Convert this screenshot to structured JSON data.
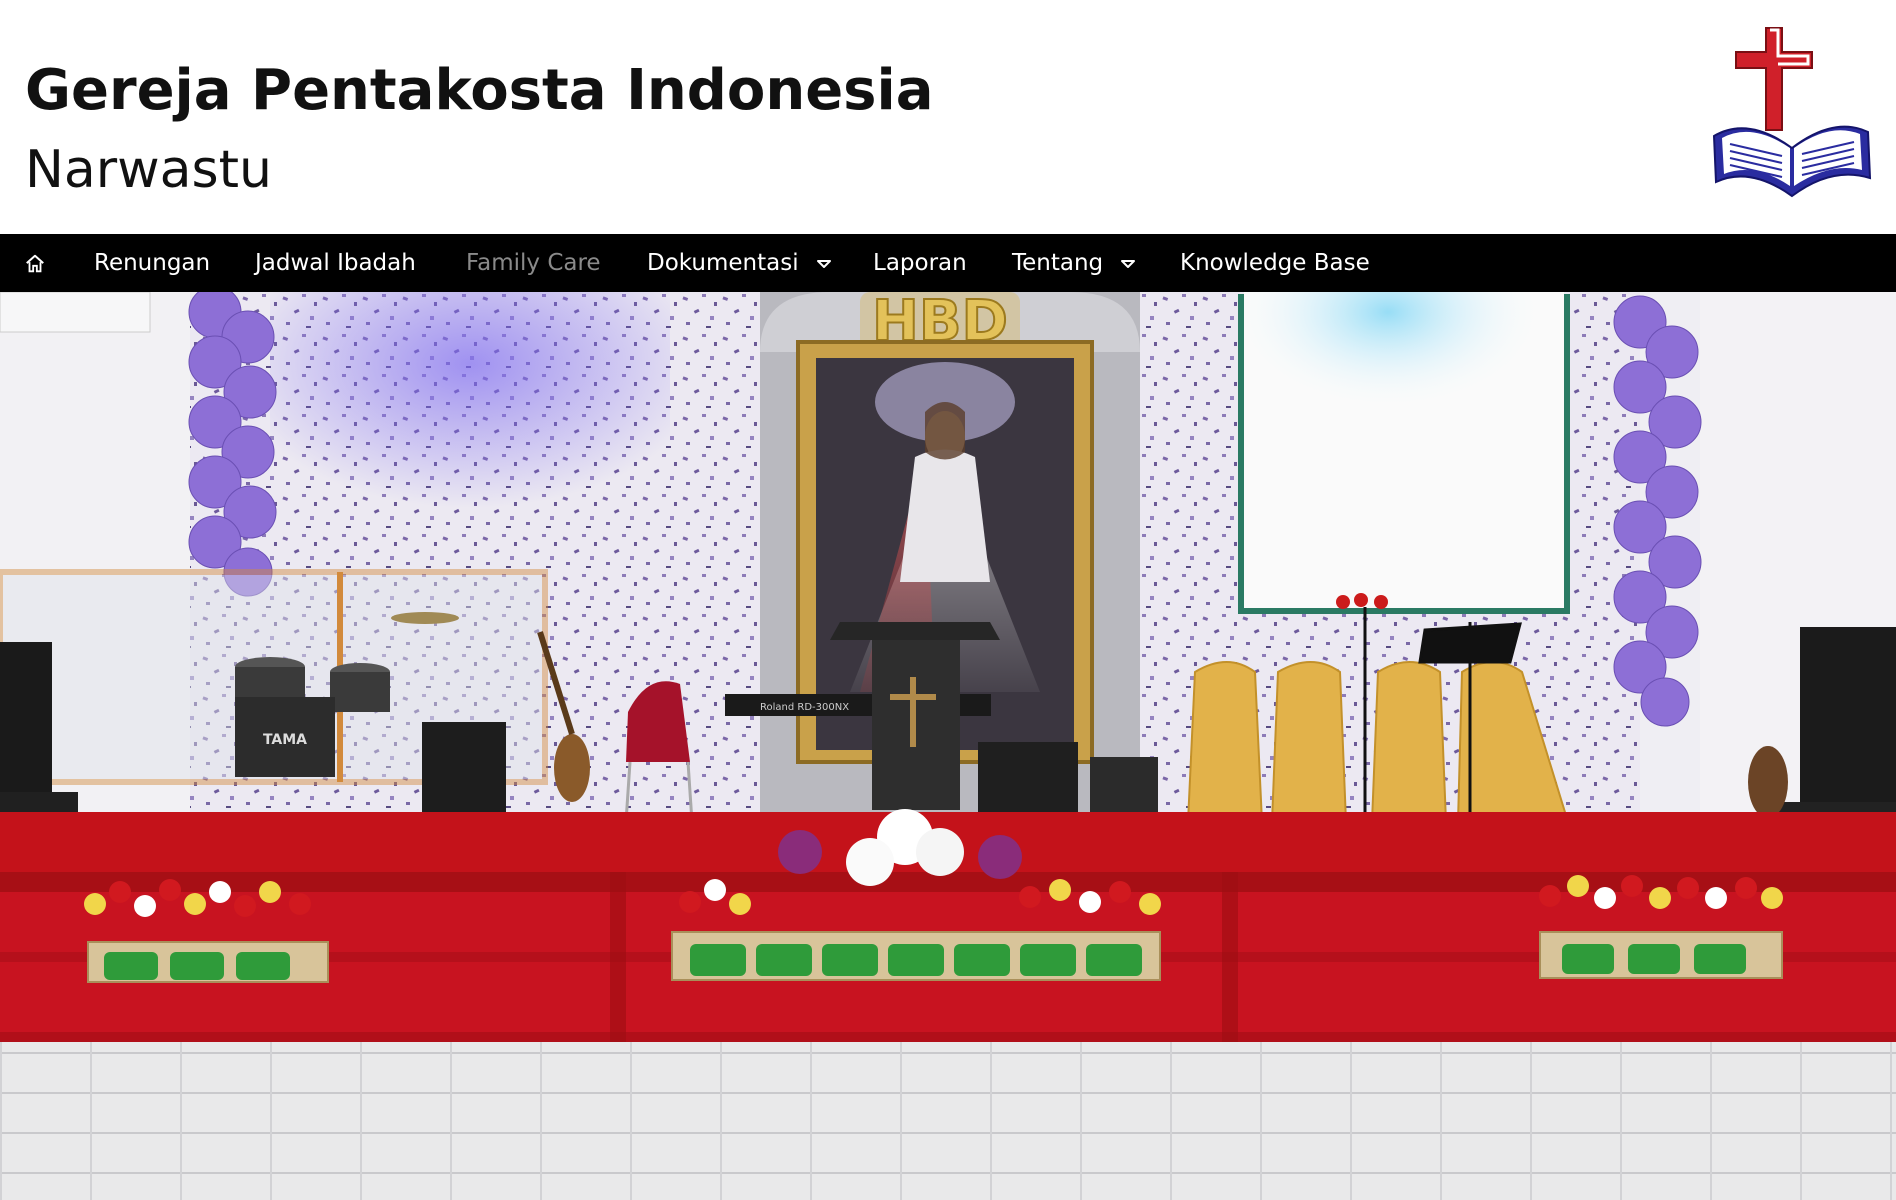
{
  "site": {
    "title": "Gereja Pentakosta Indonesia",
    "subtitle": "Narwastu"
  },
  "logo": {
    "icon": "cross-and-bible-icon",
    "cross_color": "#d0202a",
    "book_color": "#2a2ca0"
  },
  "nav": {
    "background": "#000000",
    "home_icon": "home-icon",
    "items": [
      {
        "label": "Renungan",
        "has_dropdown": false,
        "active": true
      },
      {
        "label": "Jadwal Ibadah",
        "has_dropdown": false,
        "active": true
      },
      {
        "label": "Family Care",
        "has_dropdown": false,
        "active": false
      },
      {
        "label": "Dokumentasi",
        "has_dropdown": true,
        "active": true
      },
      {
        "label": "Laporan",
        "has_dropdown": false,
        "active": true
      },
      {
        "label": "Tentang",
        "has_dropdown": true,
        "active": true
      },
      {
        "label": "Knowledge Base",
        "has_dropdown": false,
        "active": true
      }
    ]
  },
  "hero": {
    "banner_text": "HBD",
    "keyboard_label": "Roland RD-300NX",
    "drum_label": "TAMA"
  }
}
